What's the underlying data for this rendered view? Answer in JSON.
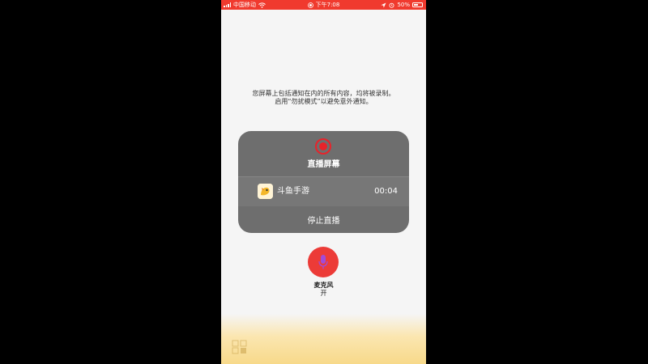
{
  "status_bar": {
    "carrier": "中国移动",
    "time": "下午7:08",
    "battery": "50%",
    "battery_level": 0.5,
    "background_color": "#f03a2e"
  },
  "notice": {
    "line1": "您屏幕上包括通知在内的所有内容，均将被录制。",
    "line2": "启用“勿扰模式”以避免意外通知。"
  },
  "broadcast_panel": {
    "title": "直播屏幕",
    "app_name": "斗鱼手游",
    "elapsed": "00:04",
    "stop_label": "停止直播",
    "record_color": "#e8232a"
  },
  "microphone": {
    "label": "麦克风",
    "state": "开",
    "button_color": "#ec3b37"
  },
  "icons": {
    "signal": "signal-bars-icon",
    "wifi": "wifi-icon",
    "recording": "screen-recording-icon",
    "location": "location-icon",
    "alarm": "alarm-icon",
    "battery": "battery-icon",
    "mic": "microphone-icon",
    "app": "douyu-app-icon"
  }
}
